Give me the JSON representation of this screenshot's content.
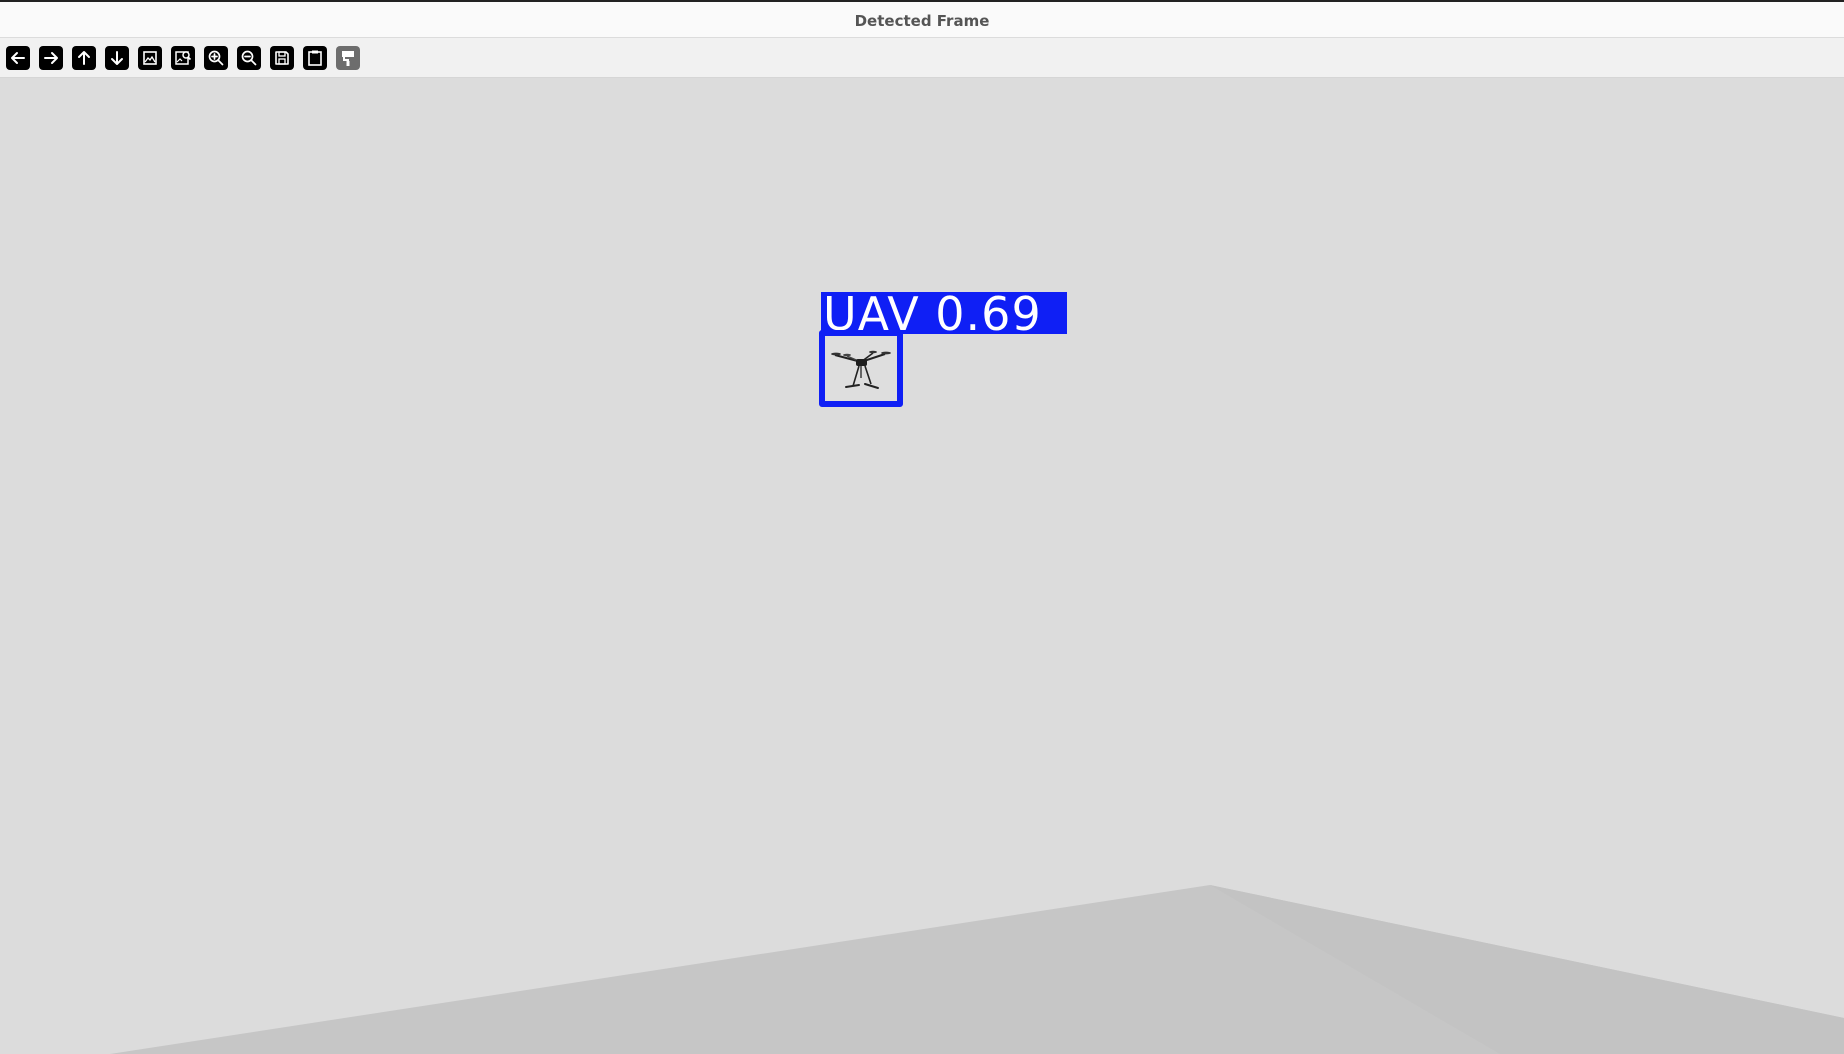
{
  "window": {
    "title": "Detected Frame"
  },
  "toolbar": {
    "buttons": [
      {
        "name": "back-button",
        "icon": "arrow-left-icon"
      },
      {
        "name": "forward-button",
        "icon": "arrow-right-icon"
      },
      {
        "name": "up-button",
        "icon": "arrow-up-icon"
      },
      {
        "name": "down-button",
        "icon": "arrow-down-icon"
      },
      {
        "name": "image-button",
        "icon": "image-icon"
      },
      {
        "name": "zoom-region-button",
        "icon": "image-search-icon"
      },
      {
        "name": "zoom-in-button",
        "icon": "zoom-in-icon"
      },
      {
        "name": "zoom-out-button",
        "icon": "zoom-out-icon"
      },
      {
        "name": "save-button",
        "icon": "save-icon"
      },
      {
        "name": "copy-button",
        "icon": "clipboard-icon"
      },
      {
        "name": "properties-button",
        "icon": "paint-roller-icon"
      }
    ]
  },
  "detection": {
    "label": "UAV 0.69",
    "color": "#0f1ff5",
    "object": "drone-icon"
  },
  "colors": {
    "background": "#dadada",
    "floor": "#c6c6c6",
    "box": "#0f1ff5"
  }
}
